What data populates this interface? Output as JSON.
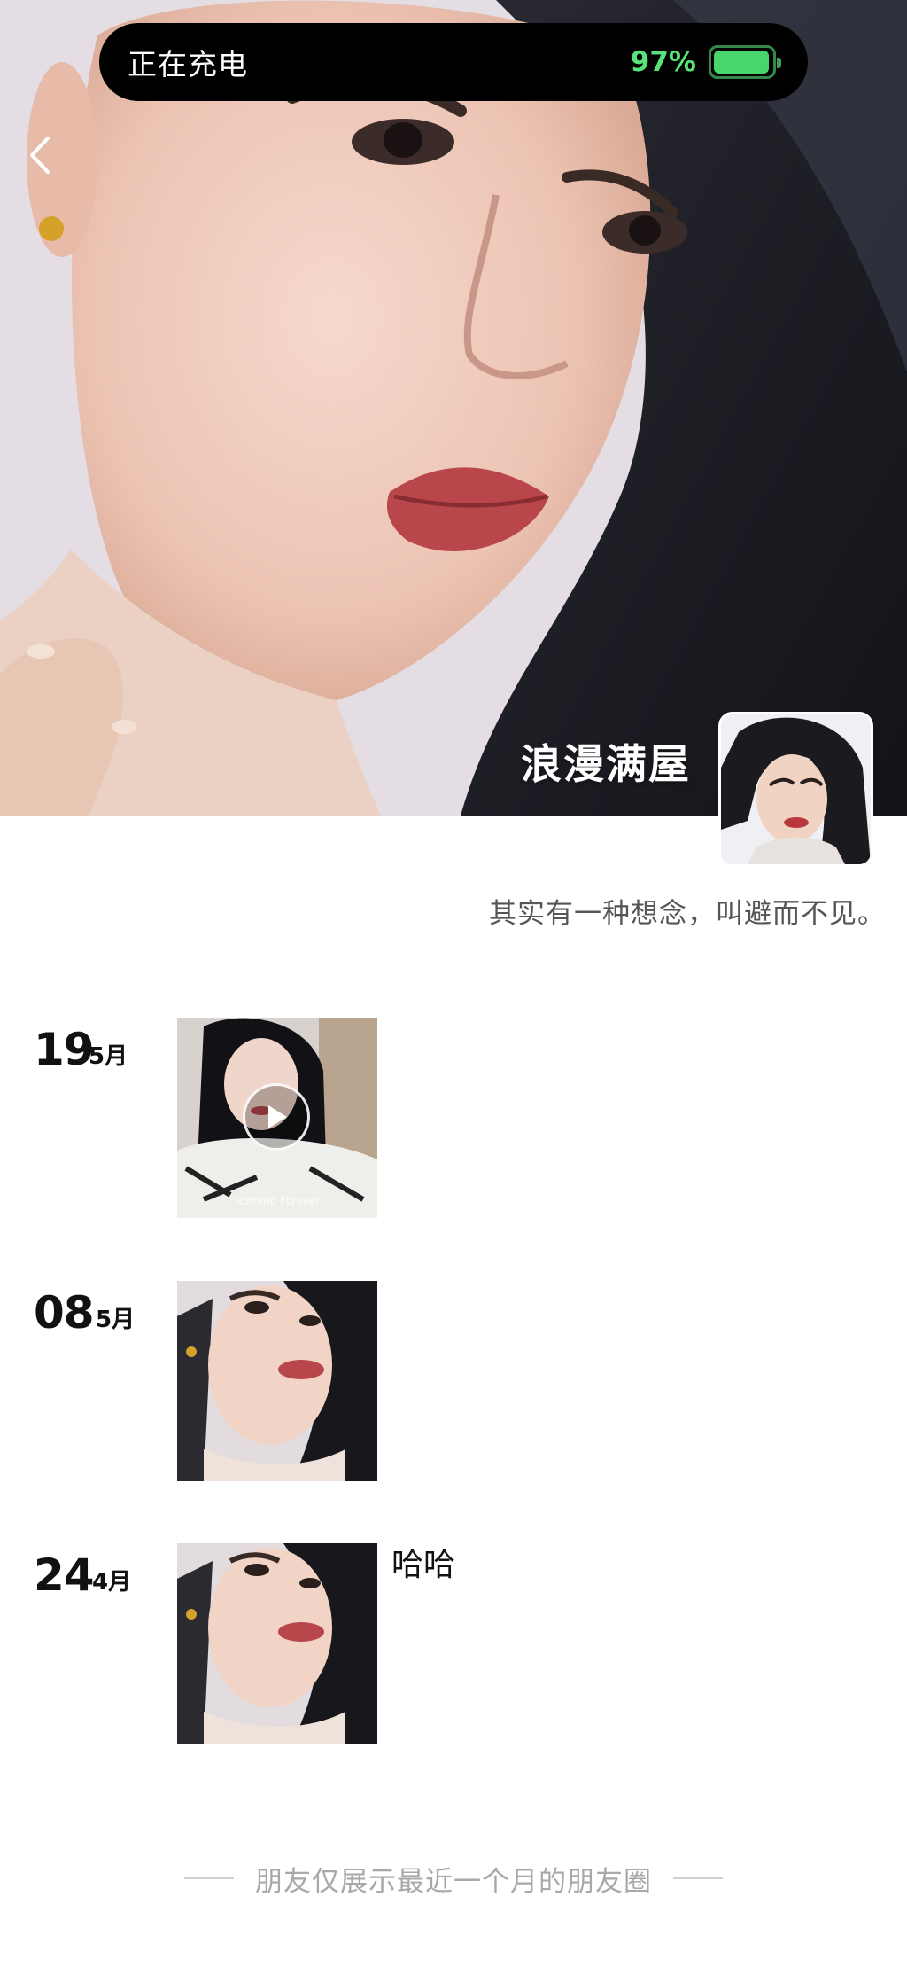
{
  "status_bar": {
    "charging_label": "正在充电",
    "battery_percent": "97%",
    "battery_level": 0.97
  },
  "profile": {
    "nickname": "浪漫满屋",
    "signature": "其实有一种想念，叫避而不见。"
  },
  "posts": [
    {
      "day": "19",
      "month": "5月",
      "media": "video",
      "text": "",
      "video_caption": "Nothing Forever"
    },
    {
      "day": "08",
      "month": "5月",
      "media": "photo",
      "text": ""
    },
    {
      "day": "24",
      "month": "4月",
      "media": "photo",
      "text": "哈哈"
    }
  ],
  "footer": {
    "note": "朋友仅展示最近一个月的朋友圈"
  },
  "icons": {
    "back": "chevron-left-icon",
    "play": "play-icon"
  },
  "colors": {
    "battery_green": "#59e27a",
    "footer_gray": "#a8a8a8"
  }
}
